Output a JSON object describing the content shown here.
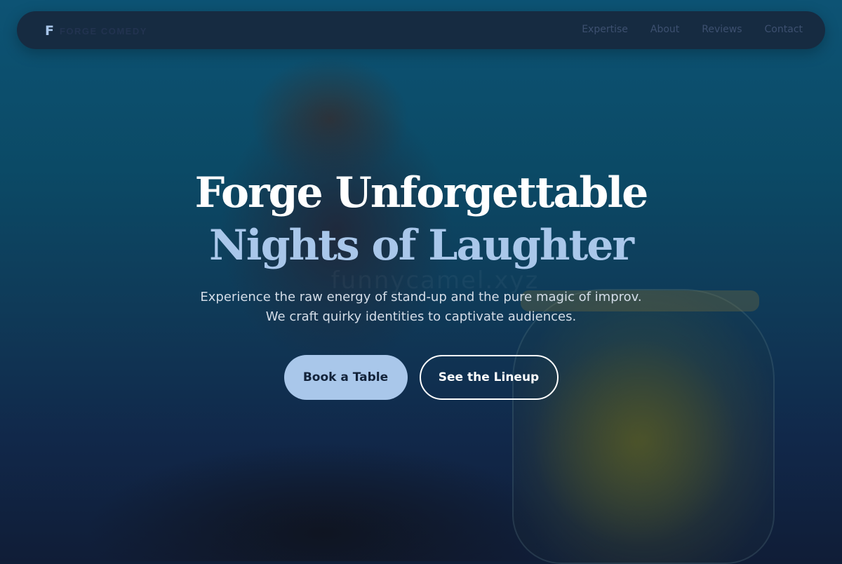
{
  "nav": {
    "logo_mark": "F",
    "logo_text": "FORGE COMEDY",
    "links": [
      "Expertise",
      "About",
      "Reviews",
      "Contact"
    ]
  },
  "hero": {
    "title_line1": "Forge Unforgettable",
    "title_line2": "Nights of Laughter",
    "subtitle_line1": "Experience the raw energy of stand-up and the pure magic of improv.",
    "subtitle_line2": "We craft quirky identities to captivate audiences.",
    "primary_cta": "Book a Table",
    "secondary_cta": "See the Lineup"
  },
  "background": {
    "watermark": "funnycamel.xyz"
  },
  "colors": {
    "accent": "#a9c7ea",
    "nav_bg": "#18263a",
    "background_top": "#0d5374",
    "background_bottom": "#101d37"
  }
}
